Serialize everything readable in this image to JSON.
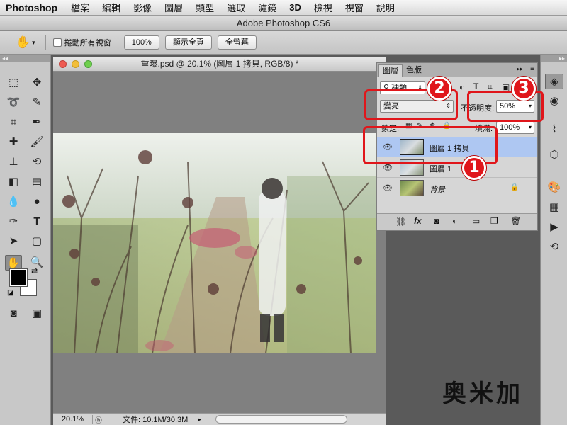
{
  "menubar": {
    "app_name": "Photoshop",
    "items": [
      "檔案",
      "編輯",
      "影像",
      "圖層",
      "類型",
      "選取",
      "濾鏡",
      "3D",
      "檢視",
      "視窗",
      "說明"
    ]
  },
  "window": {
    "title": "Adobe Photoshop CS6"
  },
  "options_bar": {
    "scroll_all_label": "捲動所有視窗",
    "zoom_100": "100%",
    "fit_screen": "顯示全頁",
    "fill_screen": "全螢幕"
  },
  "document": {
    "title": "重曝.psd @ 20.1% (圖層 1 拷貝, RGB/8) *",
    "zoom": "20.1%",
    "file_size": "文件: 10.1M/30.3M"
  },
  "layers_panel": {
    "tabs": [
      "圖層",
      "色版"
    ],
    "filter_kind": "種類",
    "blend_mode": "變亮",
    "opacity_label": "不透明度:",
    "opacity_value": "50%",
    "lock_label": "鎖定:",
    "fill_label": "填滿:",
    "fill_value": "100%",
    "layers": [
      {
        "name": "圖層 1 拷貝",
        "selected": true,
        "locked": false
      },
      {
        "name": "圖層 1",
        "selected": false,
        "locked": false
      },
      {
        "name": "背景",
        "selected": false,
        "locked": true
      }
    ]
  },
  "annotations": [
    "1",
    "2",
    "3"
  ],
  "colors": {
    "annotation_red": "#e0161b",
    "selection_blue": "#aec7f2"
  },
  "watermark": "奥米加"
}
